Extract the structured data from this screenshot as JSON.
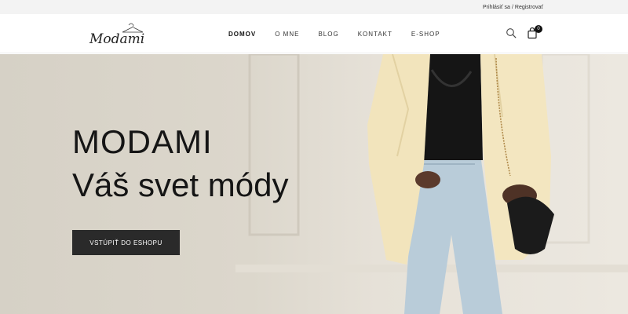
{
  "topbar": {
    "login_label": "Prihlásiť sa",
    "separator": "/",
    "register_label": "Registrovať"
  },
  "header": {
    "logo_text": "Modami",
    "nav": [
      {
        "label": "DOMOV",
        "active": true
      },
      {
        "label": "O MNE",
        "active": false
      },
      {
        "label": "BLOG",
        "active": false
      },
      {
        "label": "KONTAKT",
        "active": false
      },
      {
        "label": "E-SHOP",
        "active": false
      }
    ],
    "cart_count": "0",
    "icons": [
      "search-icon",
      "shopping-bag-icon"
    ]
  },
  "hero": {
    "title": "MODAMI",
    "subtitle": "Váš svet módy",
    "cta_label": "VSTÚPIŤ DO ESHOPU"
  },
  "colors": {
    "cta_background": "#2a2a2a",
    "topbar_background": "#f3f3f3",
    "hero_background": "#dcd7cc"
  }
}
